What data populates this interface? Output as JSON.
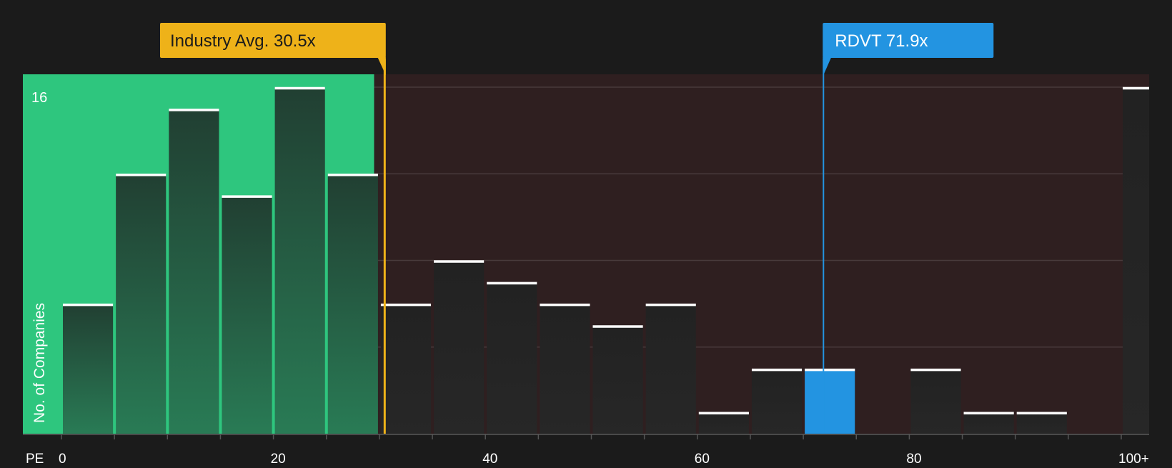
{
  "chart_data": {
    "type": "bar",
    "subtype": "histogram",
    "x_axis_prefix": "PE",
    "xlabel": "",
    "ylabel": "No. of Companies",
    "y_max_label": "16",
    "ylim": [
      0,
      16
    ],
    "y_gridlines": [
      4,
      8,
      12,
      16
    ],
    "x_ticks": [
      {
        "value": 0,
        "label": "0"
      },
      {
        "value": 20,
        "label": "20"
      },
      {
        "value": 40,
        "label": "40"
      },
      {
        "value": 60,
        "label": "60"
      },
      {
        "value": 80,
        "label": "80"
      },
      {
        "value": 100,
        "label": "100+"
      }
    ],
    "bins": [
      {
        "start": 0,
        "end": 5,
        "count": 6
      },
      {
        "start": 5,
        "end": 10,
        "count": 12
      },
      {
        "start": 10,
        "end": 15,
        "count": 15
      },
      {
        "start": 15,
        "end": 20,
        "count": 11
      },
      {
        "start": 20,
        "end": 25,
        "count": 16
      },
      {
        "start": 25,
        "end": 30,
        "count": 12
      },
      {
        "start": 30,
        "end": 35,
        "count": 6
      },
      {
        "start": 35,
        "end": 40,
        "count": 8
      },
      {
        "start": 40,
        "end": 45,
        "count": 7
      },
      {
        "start": 45,
        "end": 50,
        "count": 6
      },
      {
        "start": 50,
        "end": 55,
        "count": 5
      },
      {
        "start": 55,
        "end": 60,
        "count": 6
      },
      {
        "start": 60,
        "end": 65,
        "count": 1
      },
      {
        "start": 65,
        "end": 70,
        "count": 3
      },
      {
        "start": 70,
        "end": 75,
        "count": 3
      },
      {
        "start": 75,
        "end": 80,
        "count": 0
      },
      {
        "start": 80,
        "end": 85,
        "count": 3
      },
      {
        "start": 85,
        "end": 90,
        "count": 1
      },
      {
        "start": 90,
        "end": 95,
        "count": 1
      },
      {
        "start": 95,
        "end": 100,
        "count": 0
      },
      {
        "start": 100,
        "end": null,
        "count": 16
      }
    ],
    "industry_avg": {
      "value": 30.5,
      "label": "Industry Avg. 30.5x"
    },
    "company": {
      "value": 71.9,
      "ticker": "RDVT",
      "label": "RDVT 71.9x"
    },
    "colors": {
      "background": "#1b1b1b",
      "undervalued_zone": "#2ec67e",
      "overvalued_zone": "#2f1f20",
      "bar_dark": "#232323",
      "bar_green_top": "#213f32",
      "bar_green_bottom": "#297b55",
      "bar_top_line": "#ffffff",
      "industry": "#eeb219",
      "company": "#2394e1",
      "text": "#ffffff",
      "label_dark_text": "#1b1b1b"
    }
  }
}
